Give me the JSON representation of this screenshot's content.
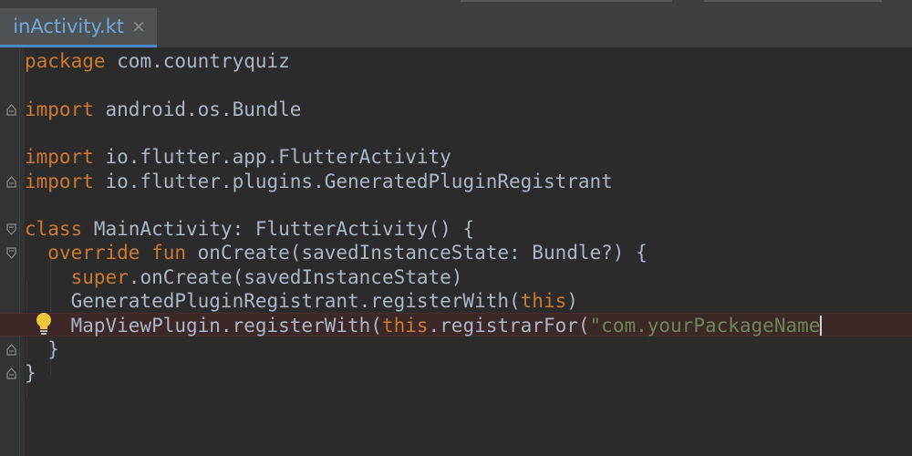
{
  "tab": {
    "label": "inActivity.kt",
    "close": "×"
  },
  "code_lines": [
    {
      "parts": [
        {
          "t": "package",
          "k": "kw"
        },
        {
          "t": " com.countryquiz",
          "k": "id"
        }
      ]
    },
    {
      "parts": []
    },
    {
      "parts": [
        {
          "t": "import",
          "k": "kw"
        },
        {
          "t": " android.os.Bundle",
          "k": "id"
        }
      ]
    },
    {
      "parts": []
    },
    {
      "parts": [
        {
          "t": "import",
          "k": "kw"
        },
        {
          "t": " io.flutter.app.FlutterActivity",
          "k": "id"
        }
      ]
    },
    {
      "parts": [
        {
          "t": "import",
          "k": "kw"
        },
        {
          "t": " io.flutter.plugins.GeneratedPluginRegistrant",
          "k": "id"
        }
      ]
    },
    {
      "parts": []
    },
    {
      "parts": [
        {
          "t": "class",
          "k": "kw"
        },
        {
          "t": " MainActivity: FlutterActivity() {",
          "k": "id"
        }
      ]
    },
    {
      "parts": [
        {
          "t": "  ",
          "k": "id"
        },
        {
          "t": "override fun",
          "k": "kw"
        },
        {
          "t": " onCreate(savedInstanceState: Bundle?) {",
          "k": "id"
        }
      ]
    },
    {
      "parts": [
        {
          "t": "    ",
          "k": "id"
        },
        {
          "t": "super",
          "k": "kw"
        },
        {
          "t": ".onCreate(savedInstanceState)",
          "k": "id"
        }
      ]
    },
    {
      "parts": [
        {
          "t": "    GeneratedPluginRegistrant.registerWith(",
          "k": "id"
        },
        {
          "t": "this",
          "k": "kw"
        },
        {
          "t": ")",
          "k": "id"
        }
      ]
    },
    {
      "parts": [
        {
          "t": "    MapViewPlugin.registerWith(",
          "k": "id"
        },
        {
          "t": "this",
          "k": "kw"
        },
        {
          "t": ".registrarFor(",
          "k": "id"
        },
        {
          "t": "\"com.yourPackageName",
          "k": "str"
        }
      ],
      "error": true,
      "cursor": true
    },
    {
      "parts": [
        {
          "t": "  }",
          "k": "id"
        }
      ]
    },
    {
      "parts": [
        {
          "t": "}",
          "k": "id"
        }
      ]
    }
  ],
  "folds": [
    {
      "line": 2,
      "kind": "end"
    },
    {
      "line": 5,
      "kind": "end"
    },
    {
      "line": 7,
      "kind": "start"
    },
    {
      "line": 8,
      "kind": "start"
    },
    {
      "line": 12,
      "kind": "end"
    },
    {
      "line": 13,
      "kind": "end"
    }
  ],
  "colors": {
    "keyword": "#cc7832",
    "identifier": "#a9b7c6",
    "string": "#6a8759",
    "tab_accent": "#4a88c7",
    "error_line": "#3b2827"
  },
  "icons": {
    "intention_bulb": "lightbulb-icon"
  }
}
